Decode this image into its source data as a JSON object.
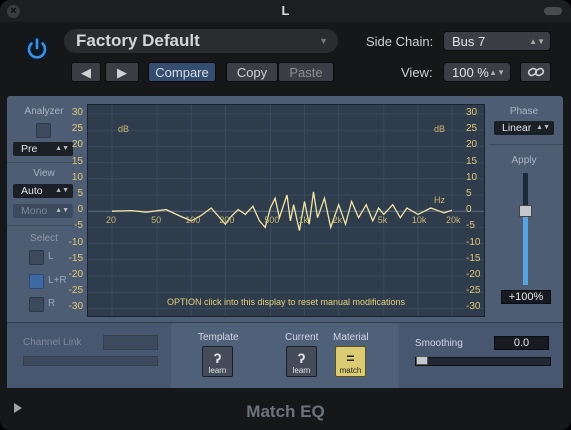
{
  "window": {
    "title": "L",
    "plugin_name": "Match EQ"
  },
  "header": {
    "preset": "Factory Default",
    "side_chain_label": "Side Chain:",
    "side_chain_value": "Bus 7",
    "compare": "Compare",
    "copy": "Copy",
    "paste": "Paste",
    "view_label": "View:",
    "view_value": "100 %",
    "prev_icon": "arrow-left",
    "next_icon": "arrow-right",
    "link_icon": "link-icon",
    "power_icon": "power-icon",
    "accent": "#3d8fe0"
  },
  "analyzer": {
    "label": "Analyzer",
    "mode": "Pre"
  },
  "view_section": {
    "label": "View",
    "mode": "Auto",
    "channel_mode": "Mono"
  },
  "select_section": {
    "label": "Select",
    "options": [
      "L",
      "L+R",
      "R"
    ],
    "selected": "L+R"
  },
  "phase": {
    "label": "Phase",
    "value": "Linear"
  },
  "apply": {
    "label": "Apply",
    "value": "+100%",
    "level": 0.63
  },
  "graph": {
    "left_unit": "dB",
    "right_unit": "dB",
    "hz_label": "Hz",
    "y_ticks": [
      "30",
      "25",
      "20",
      "15",
      "10",
      "5",
      "0",
      "-5",
      "-10",
      "-15",
      "-20",
      "-25",
      "-30"
    ],
    "x_ticks": [
      "20",
      "50",
      "100",
      "200",
      "500",
      "1k",
      "2k",
      "5k",
      "10k",
      "20k"
    ],
    "hint": "OPTION click into this display to reset manual modifications",
    "curve_color": "#f1e6a4"
  },
  "bottom": {
    "channel_link": "Channel Link",
    "template": "Template",
    "current": "Current",
    "material": "Material",
    "learn1": "learn",
    "learn2": "learn",
    "match": "match",
    "smoothing": "Smoothing",
    "smoothing_value": "0.0",
    "smoothing_level": 0.0
  }
}
